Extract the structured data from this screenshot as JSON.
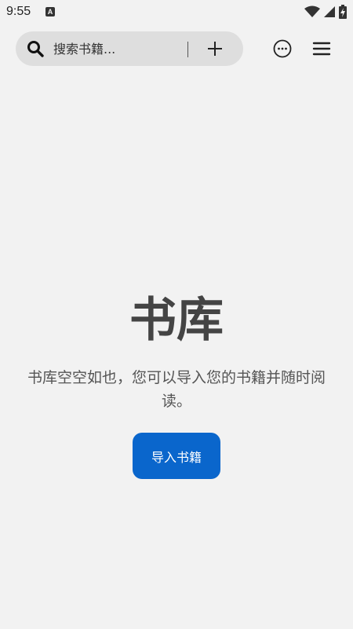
{
  "status_bar": {
    "time": "9:55",
    "notification_icon_letter": "A",
    "icons": [
      "wifi-icon",
      "cellular-signal-icon",
      "battery-charging-icon"
    ]
  },
  "top_bar": {
    "search": {
      "placeholder": "搜索书籍...",
      "value": "",
      "icon": "search-icon"
    },
    "add_icon": "plus-icon",
    "more_icon": "more-options-icon",
    "menu_icon": "hamburger-menu-icon"
  },
  "empty_state": {
    "title": "书库",
    "description": "书库空空如也，您可以导入您的书籍并随时阅读。",
    "import_button_label": "导入书籍"
  },
  "colors": {
    "background": "#f2f2f2",
    "search_pill": "#dedede",
    "primary_button": "#0a66cc",
    "text": "#444444"
  }
}
